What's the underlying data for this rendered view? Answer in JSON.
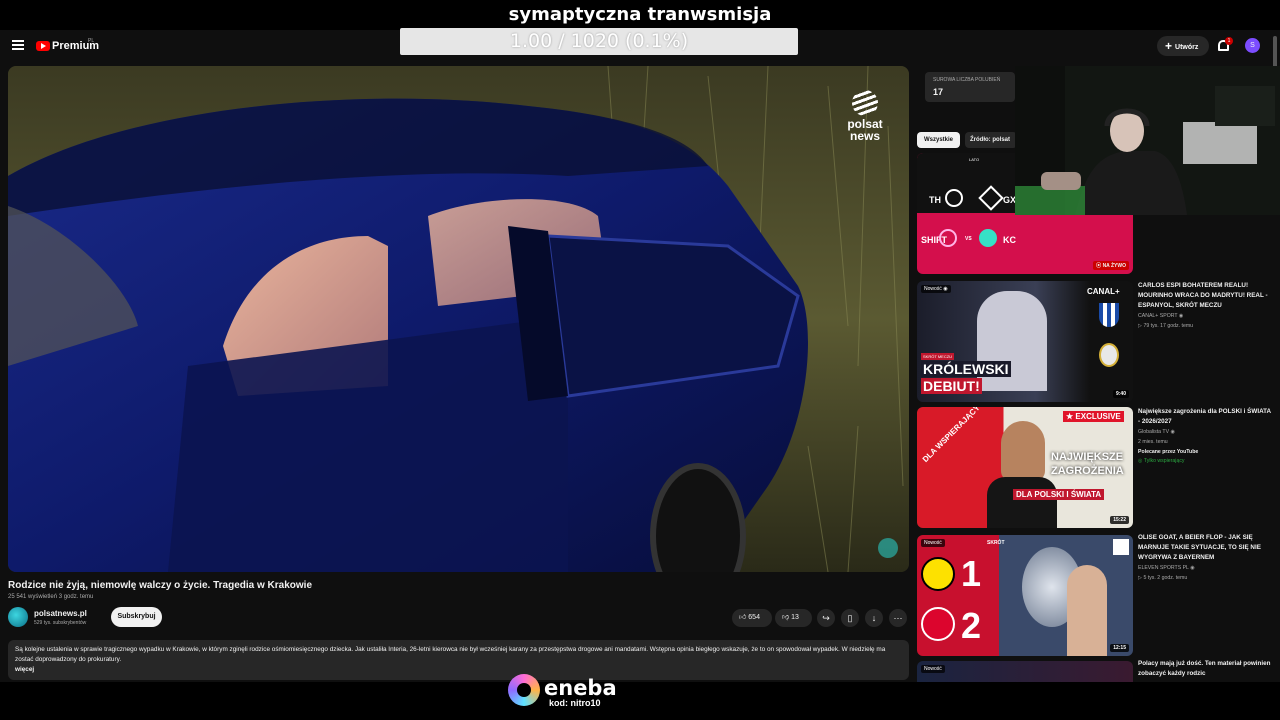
{
  "overlay": {
    "stream_title": "symaptyczna tranwsmisja",
    "goal_text": "1.00 / 1020 (0.1%)",
    "goal_progress": 0.001
  },
  "header": {
    "logo_text": "Premium",
    "logo_sup": "PL",
    "create_label": "Utwórz",
    "notifications_count": "1",
    "avatar_letter": "S"
  },
  "video": {
    "watermark": [
      "polsat",
      "news"
    ],
    "title": "Rodzice nie żyją, niemowlę walczy o życie. Tragedia w Krakowie",
    "meta": "25 541 wyświetleń  3 godz. temu",
    "channel_name": "polsatnews.pl",
    "channel_subs": "529 tys. subskrybentów",
    "subscribe_label": "Subskrybuj",
    "likes": "654",
    "dislikes": "13",
    "description": "Są kolejne ustalenia w sprawie tragicznego wypadku w Krakowie, w którym zginęli rodzice ośmiomiesięcznego dziecka. Jak ustaliła Interia, 26-letni kierowca nie był wcześniej karany za przestępstwa drogowe ani mandatami. Wstępna opinia biegłego wskazuje, że to on spowodował wypadek. W niedzielę ma zostać doprowadzony do prokuratury.",
    "more_label": "więcej"
  },
  "sidebar": {
    "stats_label": "SUROWA LICZBA POLUBIEŃ",
    "stats_value": "17",
    "chips": [
      "Wszystkie",
      "Źródło: polsat"
    ],
    "recommendations": [
      {
        "thumb_texts": [
          "LATO",
          "TH",
          "GX",
          "SHIFT",
          "VS",
          "KC"
        ],
        "live_badge": "NA ŻYWO"
      },
      {
        "title": "CARLOS ESPI BOHATEREM REALU! MOURINHO WRACA DO MADRYTU! REAL - ESPANYOL, SKRÓT MECZU",
        "channel": "CANAL+ SPORT",
        "stats": "79 tys.  17 godz. temu",
        "badge": "Nowość",
        "duration": "9:40",
        "thumb_texts": [
          "CANAL+",
          "KRÓLEWSKI",
          "DEBIUT!",
          "SKRÓT MECZU"
        ]
      },
      {
        "title": "Największe zagrożenia dla POLSKI i ŚWIATA - 2026/2027",
        "channel": "Globalista TV",
        "stats": "2 mies. temu",
        "extra": "Polecane przez YouTube",
        "members": "Tylko wspierający",
        "duration": "15:22",
        "thumb_texts": [
          "★ EXCLUSIVE",
          "NAJWIĘKSZE",
          "ZAGROŻENIA",
          "DLA POLSKI I ŚWIATA",
          "DLA WSPIERAJĄCYCH"
        ]
      },
      {
        "title": "OLISE GOAT, A BEIER FLOP - JAK SIĘ MARNUJE TAKIE SYTUACJE, TO SIĘ NIE WYGRYWA Z BAYERNEM",
        "channel": "ELEVEN SPORTS PL",
        "stats": "5 tys.  2 godz. temu",
        "badge": "Nowość",
        "duration": "12:15",
        "thumb_texts": [
          "SKRÓT",
          "1",
          "2"
        ]
      },
      {
        "title": "Polacy mają już dość. Ten materiał powinien zobaczyć każdy rodzic",
        "badge": "Nowość"
      }
    ]
  },
  "sponsor": {
    "name": "eneba",
    "code": "kod: nitro10"
  }
}
